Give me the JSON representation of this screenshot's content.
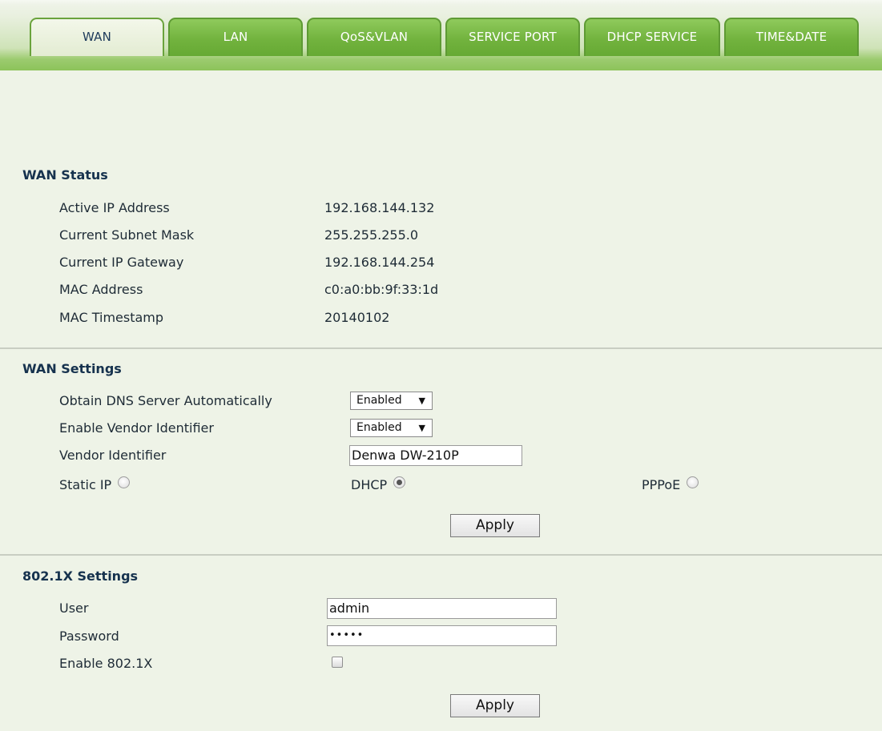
{
  "tabs": [
    {
      "label": "WAN",
      "active": true
    },
    {
      "label": "LAN",
      "active": false
    },
    {
      "label": "QoS&VLAN",
      "active": false
    },
    {
      "label": "SERVICE PORT",
      "active": false
    },
    {
      "label": "DHCP SERVICE",
      "active": false
    },
    {
      "label": "TIME&DATE",
      "active": false
    }
  ],
  "wan_status": {
    "title": "WAN Status",
    "rows": [
      {
        "label": "Active IP Address",
        "value": "192.168.144.132"
      },
      {
        "label": "Current Subnet Mask",
        "value": "255.255.255.0"
      },
      {
        "label": "Current IP Gateway",
        "value": "192.168.144.254"
      },
      {
        "label": "MAC Address",
        "value": "c0:a0:bb:9f:33:1d"
      },
      {
        "label": "MAC Timestamp",
        "value": "20140102"
      }
    ]
  },
  "wan_settings": {
    "title": "WAN Settings",
    "dns_auto": {
      "label": "Obtain DNS Server Automatically",
      "value": "Enabled"
    },
    "vendor_id_enable": {
      "label": "Enable Vendor Identifier",
      "value": "Enabled"
    },
    "vendor_id": {
      "label": "Vendor Identifier",
      "value": "Denwa DW-210P"
    },
    "mode": {
      "static_label": "Static IP",
      "dhcp_label": "DHCP",
      "pppoe_label": "PPPoE",
      "selected": "DHCP"
    },
    "apply_label": "Apply"
  },
  "dot1x_settings": {
    "title": "802.1X Settings",
    "user": {
      "label": "User",
      "value": "admin"
    },
    "password": {
      "label": "Password",
      "value": "•••••"
    },
    "enable": {
      "label": "Enable 802.1X",
      "checked": false
    },
    "apply_label": "Apply"
  },
  "colors": {
    "page_bg": "#eef3e7",
    "tab_green": "#72b33e",
    "active_tab_text": "#1d3a5a",
    "section_title": "#16324e"
  }
}
